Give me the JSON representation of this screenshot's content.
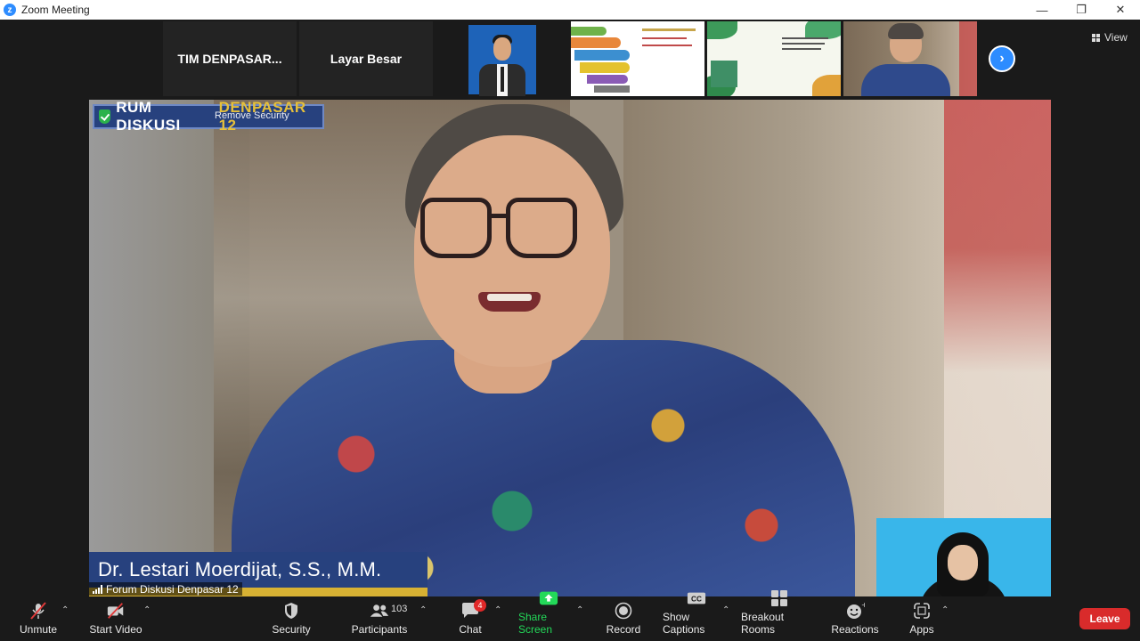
{
  "window": {
    "title": "Zoom Meeting"
  },
  "gallery": {
    "tiles": [
      {
        "label": "TIM  DENPASAR..."
      },
      {
        "label": "Layar Besar"
      }
    ],
    "view_label": "View"
  },
  "main": {
    "overlay_title": "RUM DISKUSI",
    "overlay_title2": "DENPASAR 12",
    "overlay_remove_text": "Remove Security",
    "speaker_nametag": "Dr. Lestari Moerdijat, S.S., M.M.",
    "participant_label": "Forum Diskusi Denpasar 12"
  },
  "toolbar": {
    "unmute": "Unmute",
    "start_video": "Start Video",
    "security": "Security",
    "participants": "Participants",
    "participants_count": "103",
    "chat": "Chat",
    "chat_badge": "4",
    "share_screen": "Share Screen",
    "record": "Record",
    "show_captions": "Show Captions",
    "breakout_rooms": "Breakout Rooms",
    "reactions": "Reactions",
    "apps": "Apps",
    "leave": "Leave"
  },
  "colors": {
    "accent": "#2d8cff",
    "share_green": "#23d959",
    "leave_red": "#d92b2b",
    "banner_blue": "#27417e",
    "gold": "#d7b133"
  }
}
